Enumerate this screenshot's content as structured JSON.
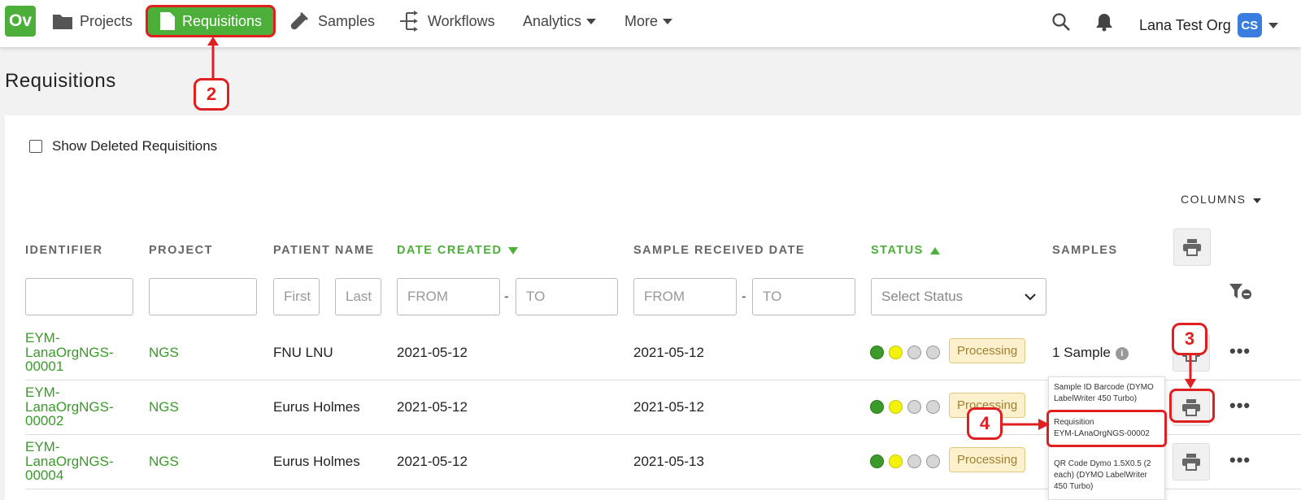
{
  "nav": {
    "logo": "Ov",
    "projects": "Projects",
    "requisitions": "Requisitions",
    "samples": "Samples",
    "workflows": "Workflows",
    "analytics": "Analytics",
    "more": "More",
    "org": "Lana Test Org",
    "avatar": "CS"
  },
  "page": {
    "title": "Requisitions",
    "show_deleted": "Show Deleted Requisitions",
    "columns": "COLUMNS"
  },
  "headers": {
    "identifier": "IDENTIFIER",
    "project": "PROJECT",
    "patient_name": "PATIENT NAME",
    "date_created": "DATE CREATED",
    "sample_received": "SAMPLE RECEIVED DATE",
    "status": "STATUS",
    "samples": "SAMPLES"
  },
  "filters": {
    "first_ph": "First",
    "last_ph": "Last",
    "from_ph": "FROM",
    "to_ph": "TO",
    "status_ph": "Select Status",
    "dash": "-"
  },
  "rows": [
    {
      "id1": "EYM-",
      "id2": "LanaOrgNGS-",
      "id3": "00001",
      "project": "NGS",
      "patient": "FNU LNU",
      "created": "2021-05-12",
      "received": "2021-05-12",
      "status": "Processing",
      "samples": "1 Sample"
    },
    {
      "id1": "EYM-",
      "id2": "LanaOrgNGS-",
      "id3": "00002",
      "project": "NGS",
      "patient": "Eurus Holmes",
      "created": "2021-05-12",
      "received": "2021-05-12",
      "status": "Processing",
      "samples": ""
    },
    {
      "id1": "EYM-",
      "id2": "LanaOrgNGS-",
      "id3": "00004",
      "project": "NGS",
      "patient": "Eurus Holmes",
      "created": "2021-05-12",
      "received": "2021-05-13",
      "status": "Processing",
      "samples": ""
    }
  ],
  "popup": {
    "item1": "Sample ID Barcode (DYMO LabelWriter 450 Turbo)",
    "item2_a": "Requisition",
    "item2_b": "EYM-LAnaOrgNGS-00002",
    "item3": "QR Code Dymo 1.5X0.5 (2 each) (DYMO LabelWriter 450 Turbo)"
  },
  "callouts": {
    "c2": "2",
    "c3": "3",
    "c4": "4"
  },
  "colors": {
    "brand_green": "#4caf3a",
    "annotation_red": "#e02020",
    "dot_green": "#3a9a2a",
    "dot_yellow": "#f2f20a",
    "dot_gray": "#d6d6d6"
  },
  "icons": {
    "more": "•••",
    "info": "i"
  }
}
